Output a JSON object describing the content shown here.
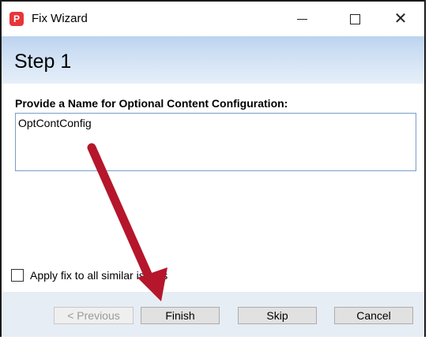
{
  "window": {
    "title": "Fix Wizard",
    "app_icon_letter": "P",
    "controls": {
      "minimize": "minimize",
      "maximize": "maximize",
      "close": "✕"
    }
  },
  "header": {
    "step_title": "Step 1"
  },
  "form": {
    "label": "Provide a Name for Optional Content Configuration:",
    "name_value": "OptContConfig"
  },
  "apply_fix": {
    "label": "Apply fix to all similar issues",
    "checked": false
  },
  "buttons": {
    "previous": "< Previous",
    "finish": "Finish",
    "skip": "Skip",
    "cancel": "Cancel"
  },
  "colors": {
    "header_gradient": "#bcd3ee",
    "footer": "#e7edf4",
    "arrow": "#b5162b",
    "icon": "#e8353a"
  }
}
